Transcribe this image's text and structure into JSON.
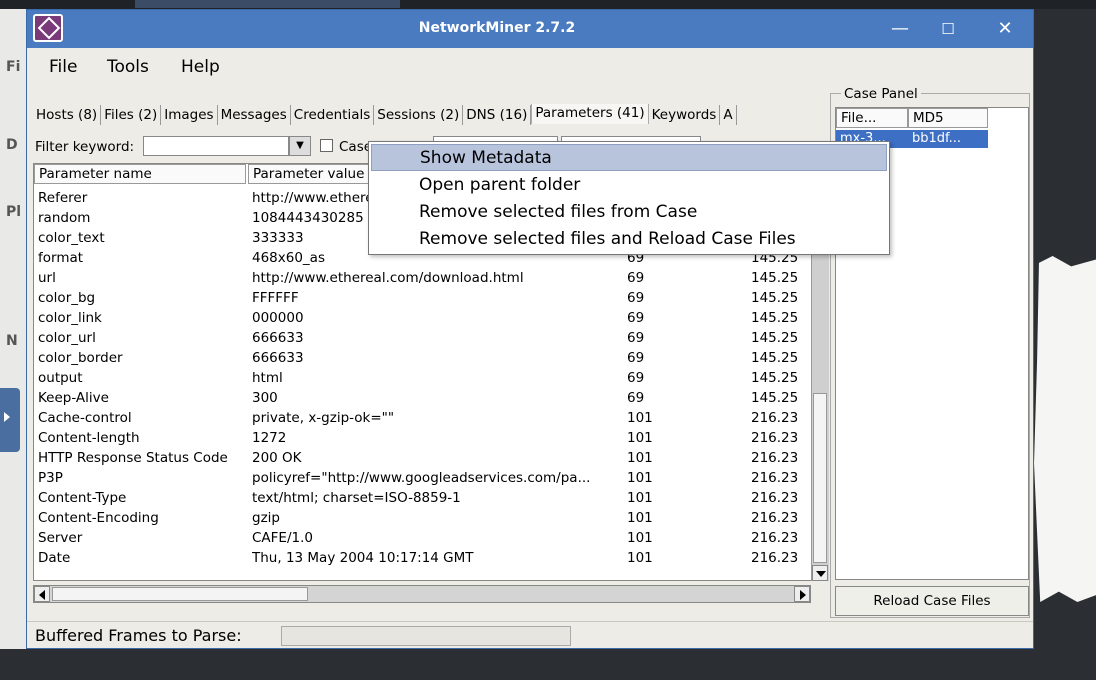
{
  "window": {
    "title": "NetworkMiner 2.7.2",
    "controls": {
      "minimize": "—",
      "maximize": "☐",
      "close": "✕"
    }
  },
  "menubar": [
    "File",
    "Tools",
    "Help"
  ],
  "tabs": [
    {
      "label": "Hosts (8)"
    },
    {
      "label": "Files (2)"
    },
    {
      "label": "Images"
    },
    {
      "label": "Messages"
    },
    {
      "label": "Credentials"
    },
    {
      "label": "Sessions (2)"
    },
    {
      "label": "DNS (16)"
    },
    {
      "label": "Parameters (41)",
      "active": true
    },
    {
      "label": "Keywords"
    },
    {
      "label": "A"
    }
  ],
  "filter": {
    "label": "Filter keyword:",
    "case_sensitive_label": "Case sensitive"
  },
  "table": {
    "headers": [
      "Parameter name",
      "Parameter value",
      "",
      ""
    ],
    "rows": [
      [
        "Referer",
        "http://www.ethereal.com/download.html",
        "",
        ""
      ],
      [
        "random",
        "1084443430285",
        "",
        ""
      ],
      [
        "color_text",
        "333333",
        "",
        ""
      ],
      [
        "format",
        "468x60_as",
        "69",
        "145.25"
      ],
      [
        "url",
        "http://www.ethereal.com/download.html",
        "69",
        "145.25"
      ],
      [
        "color_bg",
        "FFFFFF",
        "69",
        "145.25"
      ],
      [
        "color_link",
        "000000",
        "69",
        "145.25"
      ],
      [
        "color_url",
        "666633",
        "69",
        "145.25"
      ],
      [
        "color_border",
        "666633",
        "69",
        "145.25"
      ],
      [
        "output",
        "html",
        "69",
        "145.25"
      ],
      [
        "Keep-Alive",
        "300",
        "69",
        "145.25"
      ],
      [
        "Cache-control",
        "private, x-gzip-ok=\"\"",
        "101",
        "216.23"
      ],
      [
        "Content-length",
        "1272",
        "101",
        "216.23"
      ],
      [
        "HTTP Response Status Code",
        "200 OK",
        "101",
        "216.23"
      ],
      [
        "P3P",
        "policyref=\"http://www.googleadservices.com/pa...",
        "101",
        "216.23"
      ],
      [
        "Content-Type",
        "text/html; charset=ISO-8859-1",
        "101",
        "216.23"
      ],
      [
        "Content-Encoding",
        "gzip",
        "101",
        "216.23"
      ],
      [
        "Server",
        "CAFE/1.0",
        "101",
        "216.23"
      ],
      [
        "Date",
        "Thu, 13 May 2004 10:17:14 GMT",
        "101",
        "216.23"
      ]
    ]
  },
  "case_panel": {
    "title": "Case Panel",
    "headers": [
      "File...",
      "MD5"
    ],
    "row": [
      "mx-3...",
      "bb1df..."
    ],
    "reload_label": "Reload Case Files"
  },
  "status": {
    "label": "Buffered Frames to Parse:"
  },
  "context_menu": [
    {
      "label": "Show Metadata",
      "highlight": true
    },
    {
      "label": "Open parent folder"
    },
    {
      "label": "Remove selected files from Case"
    },
    {
      "label": "Remove selected files and Reload Case Files"
    }
  ],
  "desktop": {
    "left_letters": [
      "Fi",
      "D",
      "Pl",
      "N"
    ]
  },
  "colors": {
    "titlebar": "#4a7bc0",
    "selection": "#3d6fc4",
    "menu_highlight": "#b8c4dc"
  }
}
